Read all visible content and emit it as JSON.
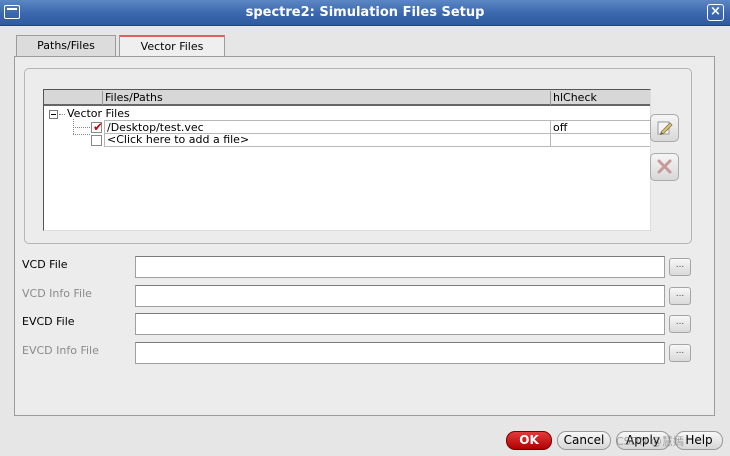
{
  "window": {
    "title": "spectre2: Simulation Files Setup",
    "close_glyph": "×"
  },
  "tabs": [
    {
      "label": "Paths/Files",
      "active": false
    },
    {
      "label": "Vector Files",
      "active": true
    }
  ],
  "table": {
    "columns": [
      "Files/Paths",
      "hlCheck"
    ],
    "group": "Vector Files",
    "rows": [
      {
        "path": "/Desktop/test.vec",
        "hlCheck": "off",
        "checked": true,
        "check_glyph": "✔"
      },
      {
        "path": "<Click here to add a file>",
        "hlCheck": "",
        "checked": false,
        "check_glyph": ""
      }
    ]
  },
  "side_buttons": [
    {
      "icon": "edit-icon"
    },
    {
      "icon": "delete-icon"
    }
  ],
  "fields": [
    {
      "label": "VCD File",
      "value": "",
      "disabled": false
    },
    {
      "label": "VCD Info File",
      "value": "",
      "disabled": true
    },
    {
      "label": "EVCD File",
      "value": "",
      "disabled": false
    },
    {
      "label": "EVCD Info File",
      "value": "",
      "disabled": true
    }
  ],
  "browse_label": "...",
  "buttons": {
    "ok": "OK",
    "cancel": "Cancel",
    "apply": "Apply",
    "help": "Help"
  },
  "watermark": "CSDN @慧嫣"
}
